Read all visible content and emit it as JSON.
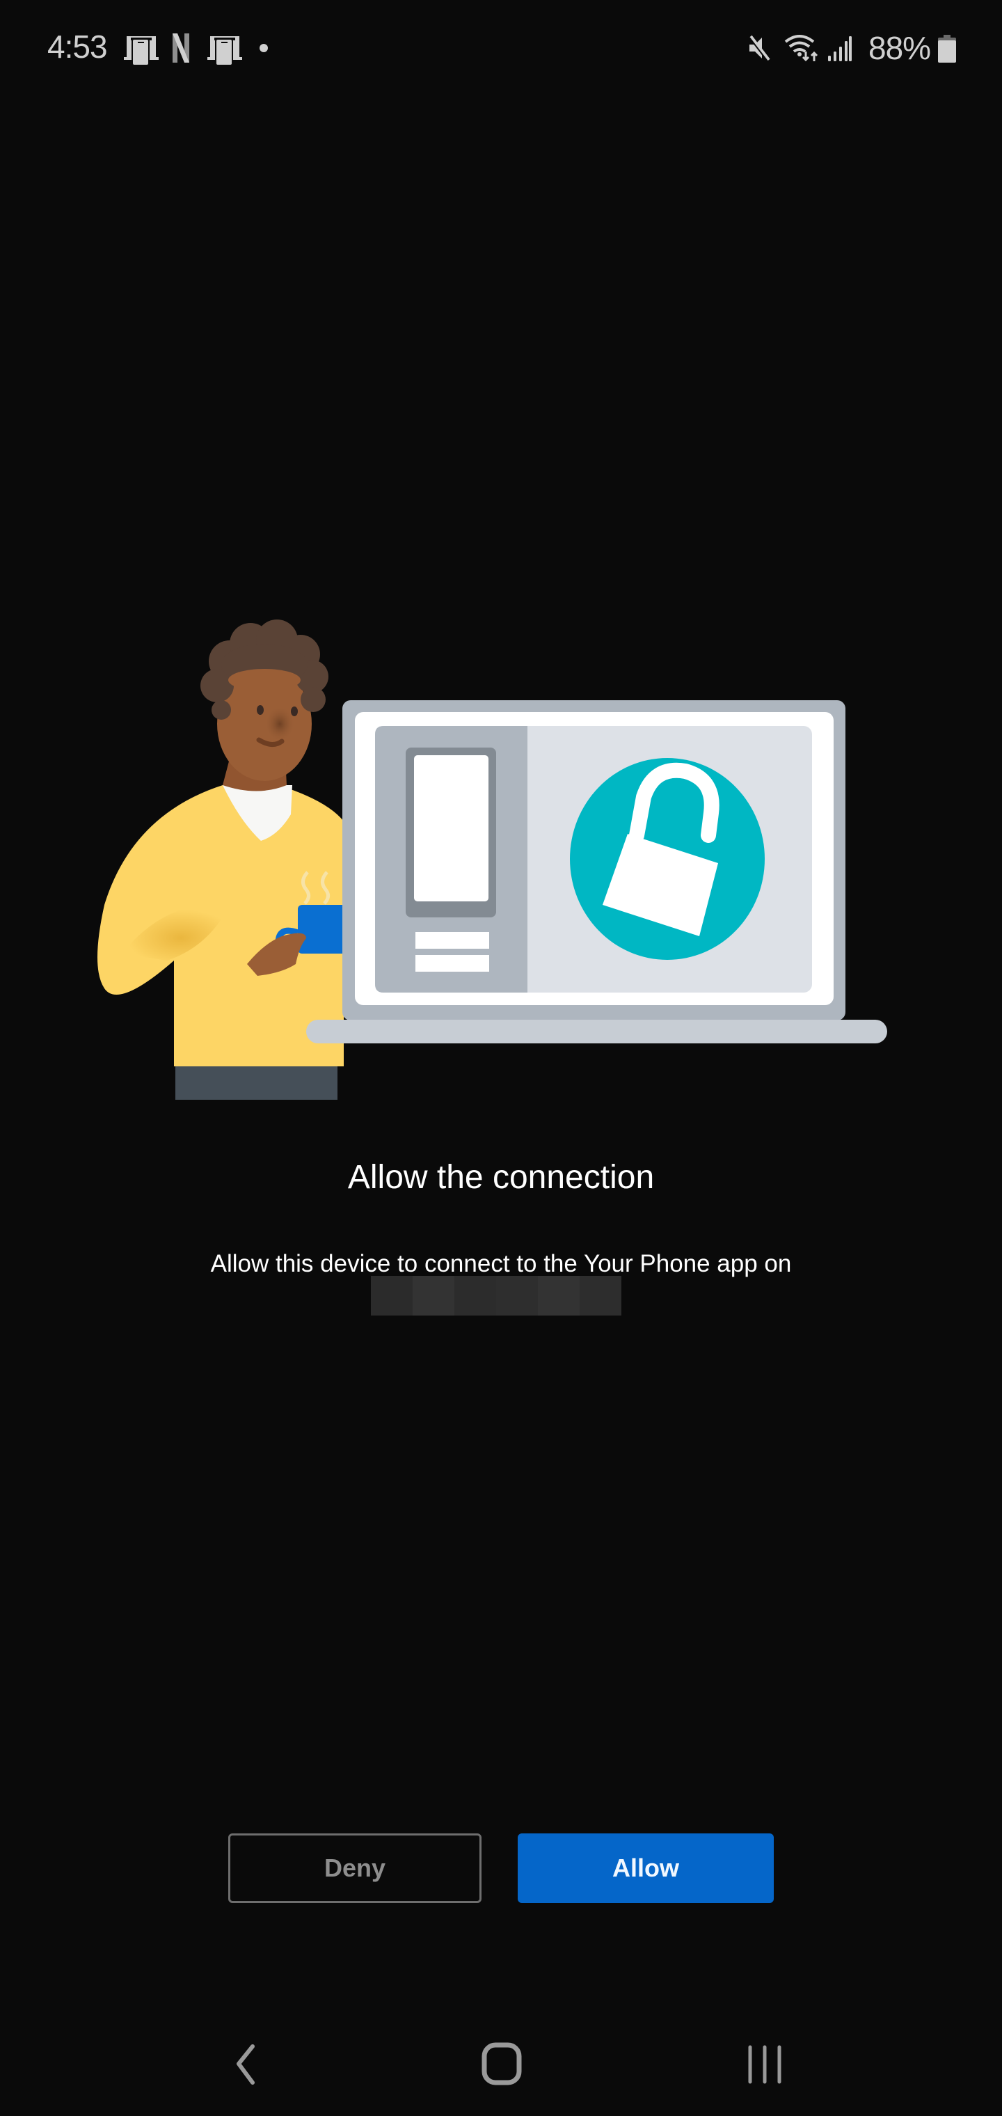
{
  "status_bar": {
    "time": "4:53",
    "left_icons": [
      "your-phone-notification-icon",
      "netflix-icon",
      "your-phone-notification-icon",
      "more-notifications-dot-icon"
    ],
    "right_icons": [
      "mute-icon",
      "wifi-data-icon",
      "signal-icon",
      "battery-icon"
    ],
    "battery_percent": "88%"
  },
  "dialog": {
    "title": "Allow the connection",
    "message": "Allow this device to connect to the Your Phone app on",
    "redacted_device_name": true
  },
  "buttons": {
    "deny_label": "Deny",
    "allow_label": "Allow"
  },
  "nav_bar": {
    "back": "back-icon",
    "home": "home-icon",
    "recents": "recents-icon"
  },
  "colors": {
    "background": "#0a0a0a",
    "accent": "#0566c9",
    "lock_circle": "#00b7c3",
    "sweater": "#fdd565"
  }
}
